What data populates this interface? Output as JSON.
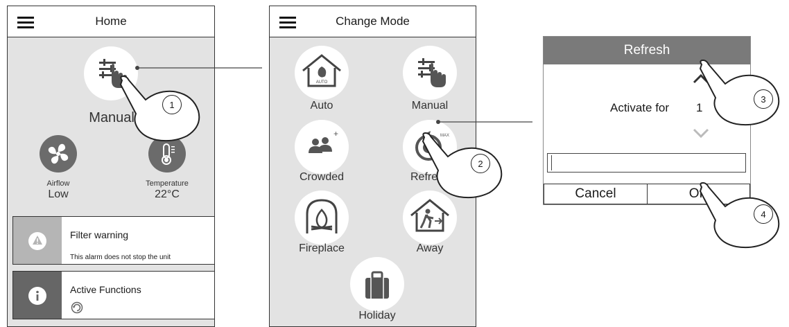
{
  "home": {
    "title": "Home",
    "mode_label": "Manual",
    "airflow": {
      "label": "Airflow",
      "value": "Low"
    },
    "temperature": {
      "label": "Temperature",
      "value": "22°C"
    },
    "alarm": {
      "title": "Filter warning",
      "subtitle": "This alarm does not stop the unit"
    },
    "functions": {
      "title": "Active Functions"
    }
  },
  "change_mode": {
    "title": "Change Mode",
    "modes": [
      {
        "label": "Auto",
        "icon_text": "AUTO"
      },
      {
        "label": "Manual"
      },
      {
        "label": "Crowded",
        "icon_text": "+"
      },
      {
        "label": "Refresh",
        "icon_text": "MAX"
      },
      {
        "label": "Fireplace"
      },
      {
        "label": "Away"
      },
      {
        "label": "Holiday"
      }
    ]
  },
  "refresh_dialog": {
    "title": "Refresh",
    "activate_label": "Activate for",
    "activate_value": "1",
    "cancel_label": "Cancel",
    "ok_label": "OK"
  },
  "steps": [
    "1",
    "2",
    "3",
    "4"
  ],
  "colors": {
    "panel_bg": "#e3e3e3",
    "icon_gray": "#6b6b6b",
    "dialog_header": "#7a7a7a"
  }
}
